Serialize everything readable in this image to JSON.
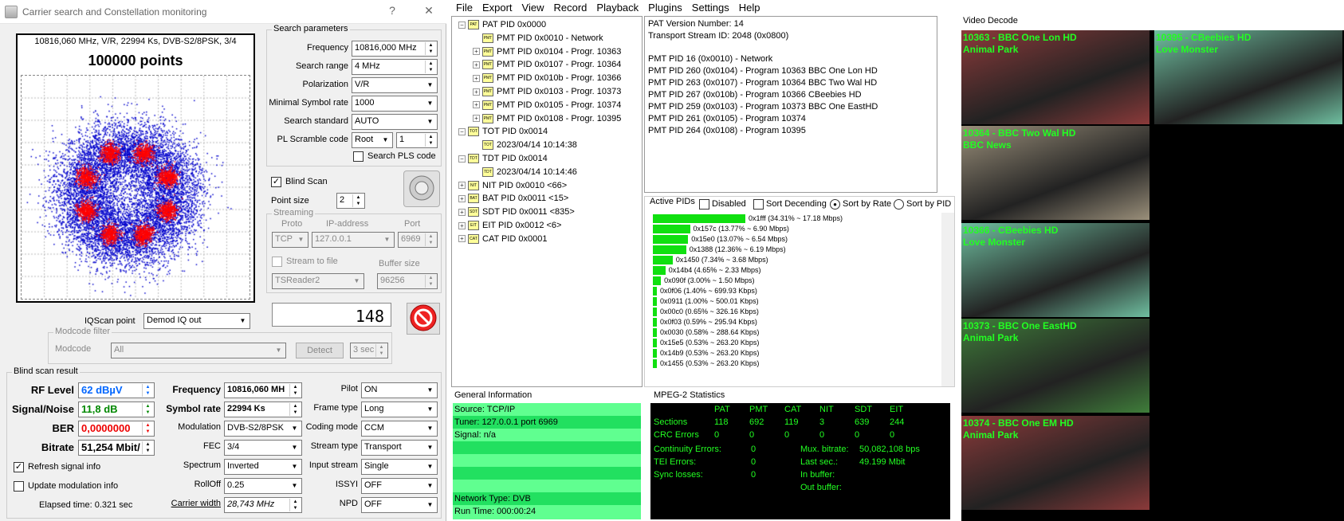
{
  "window": {
    "title": "Carrier search and Constellation monitoring",
    "help": "?",
    "close": "✕"
  },
  "scope": {
    "header": "10816,060 MHz, V/R, 22994 Ks, DVB-S2/8PSK, 3/4",
    "points": "100000 points"
  },
  "search": {
    "title": "Search parameters",
    "frequency_label": "Frequency",
    "frequency": "10816,000 MHz",
    "range_label": "Search range",
    "range": "4 MHz",
    "polarization_label": "Polarization",
    "polarization": "V/R",
    "minsr_label": "Minimal Symbol rate",
    "minsr": "1000",
    "standard_label": "Search standard",
    "standard": "AUTO",
    "pls_label": "PL Scramble code",
    "pls_mode": "Root",
    "pls_value": "1",
    "search_pls": "Search PLS code"
  },
  "blind": {
    "label": "Blind Scan",
    "pointsize_label": "Point size",
    "pointsize": "2"
  },
  "streaming": {
    "title": "Streaming",
    "proto_label": "Proto",
    "ip_label": "IP-address",
    "port_label": "Port",
    "proto": "TCP",
    "ip": "127.0.0.1",
    "port": "6969",
    "stream_to_file": "Stream to file",
    "buffer_label": "Buffer size",
    "reader": "TSReader2",
    "buffer": "96256"
  },
  "iq": {
    "label": "IQScan point",
    "value": "Demod IQ out",
    "counter": "148"
  },
  "modcode": {
    "title": "Modcode filter",
    "label": "Modcode",
    "value": "All",
    "detect": "Detect",
    "time": "3 sec"
  },
  "result": {
    "title": "Blind scan result",
    "rf_label": "RF Level",
    "rf": "62 dBµV",
    "sn_label": "Signal/Noise",
    "sn": "11,8 dB",
    "ber_label": "BER",
    "ber": "0,0000000",
    "bitrate_label": "Bitrate",
    "bitrate": "51,254 Mbit/",
    "freq_label": "Frequency",
    "freq": "10816,060 MH",
    "sr_label": "Symbol rate",
    "sr": "22994 Ks",
    "mod_label": "Modulation",
    "mod": "DVB-S2/8PSK",
    "fec_label": "FEC",
    "fec": "3/4",
    "spec_label": "Spectrum",
    "spec": "Inverted",
    "roll_label": "RollOff",
    "roll": "0.25",
    "cw_label": "Carrier width",
    "cw": "28,743 MHz",
    "pilot_label": "Pilot",
    "pilot": "ON",
    "frame_label": "Frame type",
    "frame": "Long",
    "coding_label": "Coding mode",
    "coding": "CCM",
    "stype_label": "Stream type",
    "stype": "Transport",
    "istream_label": "Input stream",
    "istream": "Single",
    "issyi_label": "ISSYI",
    "issyi": "OFF",
    "npd_label": "NPD",
    "npd": "OFF",
    "refresh": "Refresh signal info",
    "update": "Update modulation info",
    "elapsed": "Elapsed time: 0.321 sec"
  },
  "menu": [
    "File",
    "Export",
    "View",
    "Record",
    "Playback",
    "Plugins",
    "Settings",
    "Help"
  ],
  "tree": [
    {
      "t": "PAT PID 0x0000",
      "lvl": 0,
      "pm": "−",
      "icon": "PAT"
    },
    {
      "t": "PMT PID 0x0010 - Network",
      "lvl": 1,
      "pm": "",
      "icon": "PMT"
    },
    {
      "t": "PMT PID 0x0104 - Progr. 10363",
      "lvl": 1,
      "pm": "+",
      "icon": "PMT"
    },
    {
      "t": "PMT PID 0x0107 - Progr. 10364",
      "lvl": 1,
      "pm": "+",
      "icon": "PMT"
    },
    {
      "t": "PMT PID 0x010b - Progr. 10366",
      "lvl": 1,
      "pm": "+",
      "icon": "PMT"
    },
    {
      "t": "PMT PID 0x0103 - Progr. 10373",
      "lvl": 1,
      "pm": "+",
      "icon": "PMT"
    },
    {
      "t": "PMT PID 0x0105 - Progr. 10374",
      "lvl": 1,
      "pm": "+",
      "icon": "PMT"
    },
    {
      "t": "PMT PID 0x0108 - Progr. 10395",
      "lvl": 1,
      "pm": "+",
      "icon": "PMT"
    },
    {
      "t": "TOT PID 0x0014",
      "lvl": 0,
      "pm": "−",
      "icon": "TOT"
    },
    {
      "t": "2023/04/14 10:14:38",
      "lvl": 1,
      "pm": "",
      "icon": "TOT"
    },
    {
      "t": "TDT PID 0x0014",
      "lvl": 0,
      "pm": "−",
      "icon": "TDT"
    },
    {
      "t": "2023/04/14 10:14:46",
      "lvl": 1,
      "pm": "",
      "icon": "TDT"
    },
    {
      "t": "NIT PID 0x0010 <66>",
      "lvl": 0,
      "pm": "+",
      "icon": "NIT"
    },
    {
      "t": "BAT PID 0x0011 <15>",
      "lvl": 0,
      "pm": "+",
      "icon": "BAT"
    },
    {
      "t": "SDT PID 0x0011 <835>",
      "lvl": 0,
      "pm": "+",
      "icon": "SDT"
    },
    {
      "t": "EIT PID 0x0012 <6>",
      "lvl": 0,
      "pm": "+",
      "icon": "EIT"
    },
    {
      "t": "CAT PID 0x0001",
      "lvl": 0,
      "pm": "+",
      "icon": "CAT"
    }
  ],
  "info": [
    "PAT Version Number: 14",
    "Transport Stream ID: 2048 (0x0800)",
    "",
    "PMT PID 16 (0x0010) - Network",
    "PMT PID 260 (0x0104) - Program 10363 BBC One Lon HD",
    "PMT PID 263 (0x0107) - Program 10364 BBC Two Wal HD",
    "PMT PID 267 (0x010b) - Program 10366 CBeebies HD",
    "PMT PID 259 (0x0103) - Program 10373 BBC One EastHD",
    "PMT PID 261 (0x0105) - Program 10374",
    "PMT PID 264 (0x0108) - Program 10395"
  ],
  "active": {
    "title": "Active PIDs",
    "disabled": "Disabled",
    "desc": "Sort Decending",
    "byrate": "Sort by Rate",
    "bypid": "Sort by PID",
    "pids": [
      {
        "l": "0x1fff (34.31% ~ 17.18 Mbps)",
        "p": 34.31
      },
      {
        "l": "0x157c (13.77% ~ 6.90 Mbps)",
        "p": 13.77
      },
      {
        "l": "0x15e0 (13.07% ~ 6.54 Mbps)",
        "p": 13.07
      },
      {
        "l": "0x1388 (12.36% ~ 6.19 Mbps)",
        "p": 12.36
      },
      {
        "l": "0x1450 (7.34% ~ 3.68 Mbps)",
        "p": 7.34
      },
      {
        "l": "0x14b4 (4.65% ~ 2.33 Mbps)",
        "p": 4.65
      },
      {
        "l": "0x090f (3.00% ~ 1.50 Mbps)",
        "p": 3.0
      },
      {
        "l": "0x0f06 (1.40% ~ 699.93 Kbps)",
        "p": 1.4
      },
      {
        "l": "0x0911 (1.00% ~ 500.01 Kbps)",
        "p": 1.0
      },
      {
        "l": "0x00c0 (0.65% ~ 326.16 Kbps)",
        "p": 0.65
      },
      {
        "l": "0x0f03 (0.59% ~ 295.94 Kbps)",
        "p": 0.59
      },
      {
        "l": "0x0030 (0.58% ~ 288.64 Kbps)",
        "p": 0.58
      },
      {
        "l": "0x15e5 (0.53% ~ 263.20 Kbps)",
        "p": 0.53
      },
      {
        "l": "0x14b9 (0.53% ~ 263.20 Kbps)",
        "p": 0.53
      },
      {
        "l": "0x1455 (0.53% ~ 263.20 Kbps)",
        "p": 0.53
      }
    ]
  },
  "general": {
    "title": "General Information",
    "rows": [
      "Source: TCP/IP",
      "Tuner: 127.0.0.1 port 6969",
      "Signal: n/a",
      "",
      "",
      "",
      "",
      "Network Type: DVB",
      "Run Time: 000:00:24"
    ]
  },
  "mpeg": {
    "title": "MPEG-2 Statistics",
    "cols": [
      "PAT",
      "PMT",
      "CAT",
      "NIT",
      "SDT",
      "EIT"
    ],
    "sections_label": "Sections",
    "sections": [
      "118",
      "692",
      "119",
      "3",
      "639",
      "244"
    ],
    "crc_label": "CRC Errors",
    "crc": [
      "0",
      "0",
      "0",
      "0",
      "0",
      "0"
    ],
    "cont_label": "Continuity Errors:",
    "cont": "0",
    "tei_label": "TEI Errors:",
    "tei": "0",
    "sync_label": "Sync losses:",
    "sync": "0",
    "mux_label": "Mux. bitrate:",
    "mux": "50,082,108 bps",
    "last_label": "Last sec.:",
    "last": "49.199 Mbit",
    "inbuf_label": "In buffer:",
    "outbuf_label": "Out buffer:"
  },
  "video": {
    "title": "Video Decode",
    "tiles": [
      {
        "cap": "10363 - BBC One Lon HD\nAnimal Park"
      },
      {
        "cap": "10395 - CBeebies HD\nLove Monster"
      },
      {
        "cap": "10364 - BBC Two Wal HD\nBBC News"
      },
      {
        "cap": "10366 - CBeebies HD\nLove Monster"
      },
      {
        "cap": "10373 - BBC One EastHD\nAnimal Park"
      },
      {
        "cap": "10374 - BBC One EM HD\nAnimal Park"
      }
    ]
  }
}
